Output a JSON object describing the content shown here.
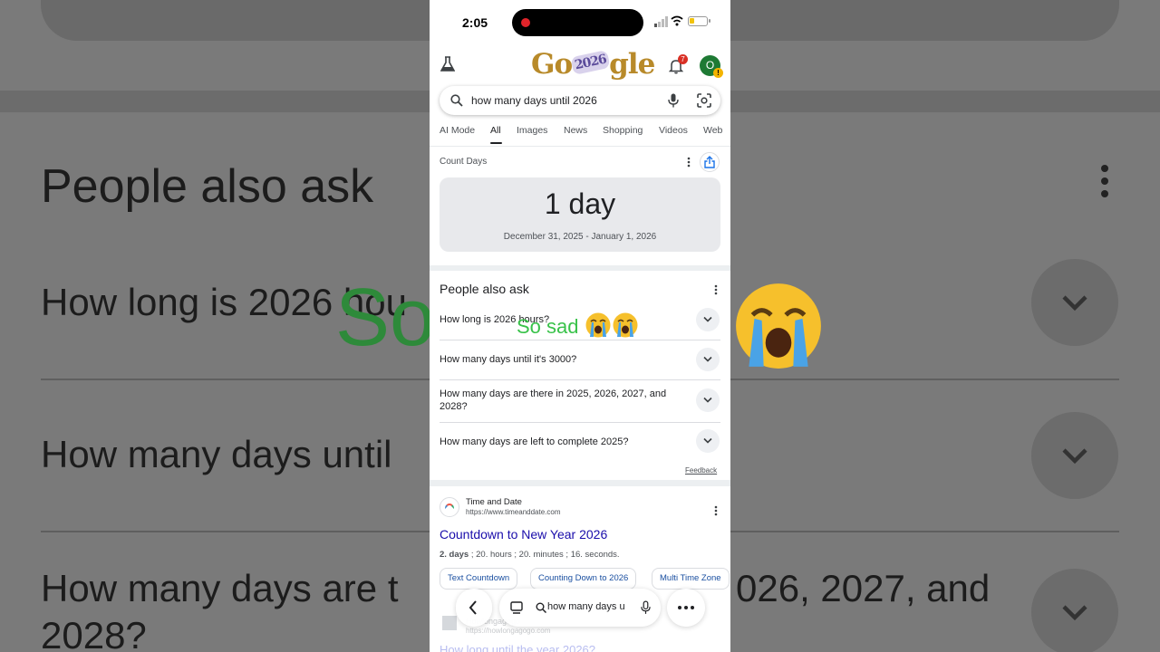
{
  "background_copy": {
    "heading": "People also ask",
    "q1": "How long is 2026 hou",
    "q2": "How many days until",
    "q3_line1": "How many days are t",
    "q3_line2": "2028?",
    "q3_right": "026, 2027, and",
    "overlay_fragment": "So"
  },
  "status_bar": {
    "time": "2:05"
  },
  "header": {
    "doodle_text": "Go",
    "doodle_year": "2026",
    "doodle_tail": "gle",
    "notification_count": "7",
    "avatar_initial": "O"
  },
  "search": {
    "query": "how many days until 2026"
  },
  "tabs": [
    {
      "label": "AI Mode"
    },
    {
      "label": "All",
      "active": true
    },
    {
      "label": "Images"
    },
    {
      "label": "News"
    },
    {
      "label": "Shopping"
    },
    {
      "label": "Videos"
    },
    {
      "label": "Web"
    }
  ],
  "count_days": {
    "title": "Count Days",
    "result": "1 day",
    "range": "December 31, 2025 - January 1, 2026"
  },
  "people_also_ask": {
    "title": "People also ask",
    "questions": [
      "How long is 2026 hours?",
      "How many days until it's 3000?",
      "How many days are there in 2025, 2026, 2027, and 2028?",
      "How many days are left to complete 2025?"
    ],
    "feedback": "Feedback"
  },
  "result": {
    "site_name": "Time and Date",
    "url": "https://www.timeanddate.com",
    "title": "Countdown to New Year 2026",
    "snippet_parts": [
      "2. days",
      " ; 20. hours ; 20. minutes ; 16. seconds."
    ],
    "chips": [
      "Text Countdown",
      "Counting Down to 2026",
      "Multi Time Zone"
    ]
  },
  "next_result": {
    "site_name": "Howlongagogo",
    "url": "https://howlongagogo.com",
    "title": "How long until the year 2026?"
  },
  "bottom_bar": {
    "query": "how many days u"
  },
  "overlay_caption": "So sad",
  "colors": {
    "link": "#1a0dab",
    "caption": "#39c24a",
    "chip_text": "#1a4fa0"
  }
}
